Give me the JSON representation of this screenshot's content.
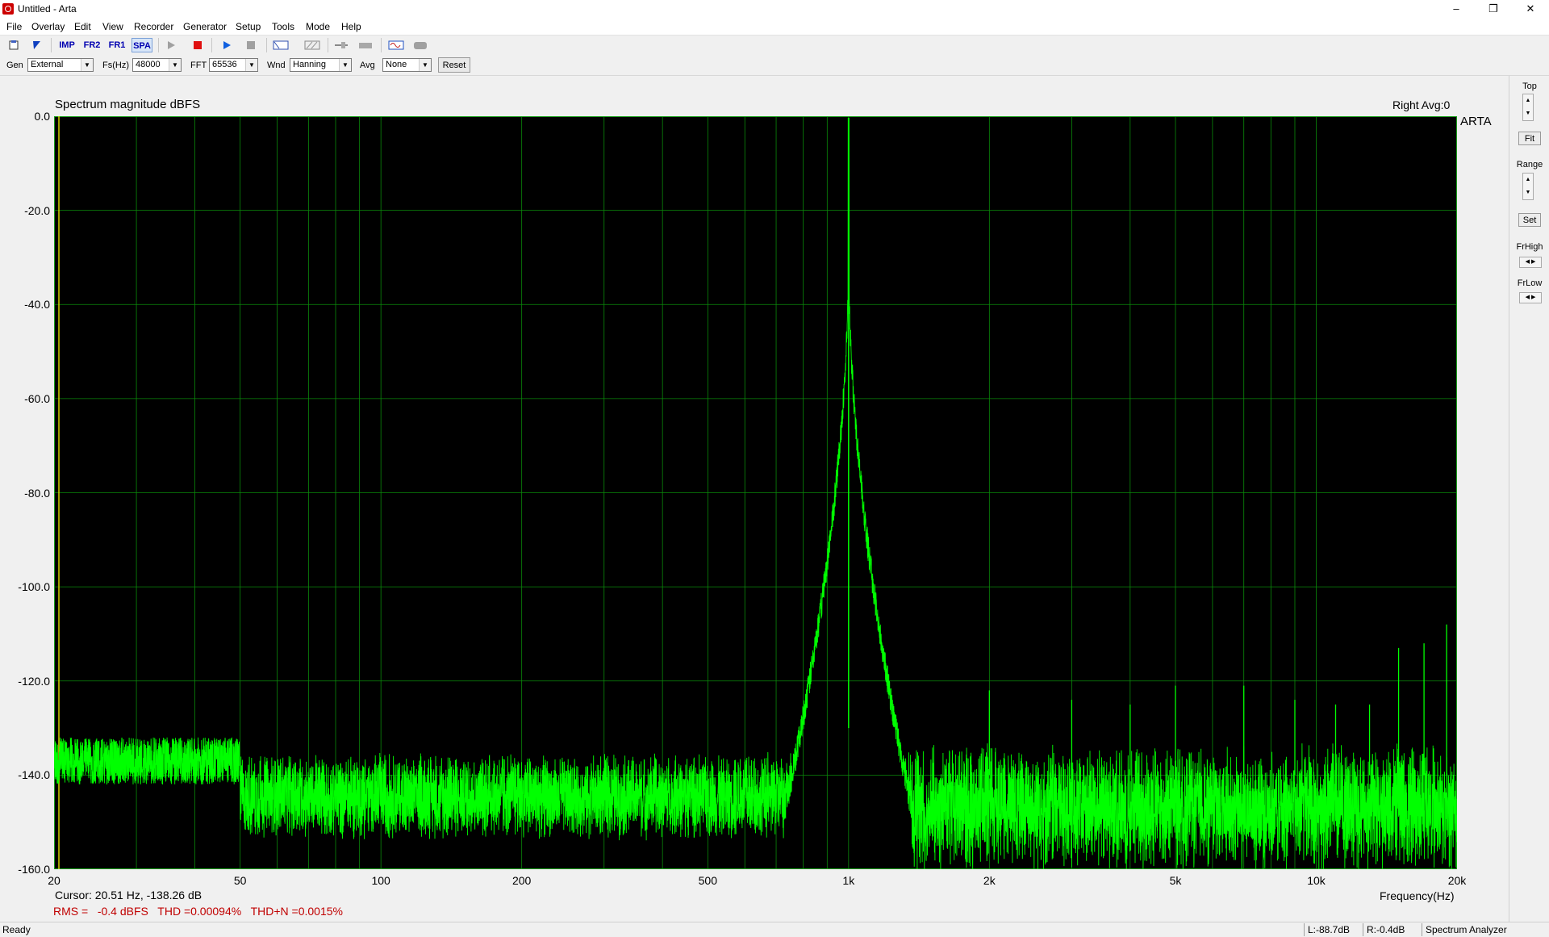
{
  "window": {
    "title": "Untitled - Arta",
    "minimize": "–",
    "restore": "❐",
    "close": "✕"
  },
  "menu": [
    "File",
    "Overlay",
    "Edit",
    "View",
    "Recorder",
    "Generator",
    "Setup",
    "Tools",
    "Mode",
    "Help"
  ],
  "toolbar": {
    "imp": "IMP",
    "fr2": "FR2",
    "fr1": "FR1",
    "spa": "SPA"
  },
  "params": {
    "gen_label": "Gen",
    "gen_value": "External",
    "fs_label": "Fs(Hz)",
    "fs_value": "48000",
    "fft_label": "FFT",
    "fft_value": "65536",
    "wnd_label": "Wnd",
    "wnd_value": "Hanning",
    "avg_label": "Avg",
    "avg_value": "None",
    "reset_label": "Reset"
  },
  "plot": {
    "title": "Spectrum magnitude dBFS",
    "right_label": "Right  Avg:0",
    "logo": "ARTA",
    "xlabel": "Frequency(Hz)",
    "cursor": "Cursor: 20.51 Hz, -138.26 dB",
    "measurement": "RMS =   -0.4 dBFS   THD =0.00094%   THD+N =0.0015%",
    "colors": {
      "background": "#000000",
      "grid": "#0a8a0a",
      "trace": "#00ff00",
      "measure": "#c00000"
    }
  },
  "chart_data": {
    "type": "line",
    "title": "Spectrum magnitude dBFS",
    "xlabel": "Frequency(Hz)",
    "ylabel": "",
    "xscale": "log",
    "xlim": [
      20,
      20000
    ],
    "ylim": [
      -160,
      0
    ],
    "y_ticks": [
      "0.0",
      "-20.0",
      "-40.0",
      "-60.0",
      "-80.0",
      "-100.0",
      "-120.0",
      "-140.0",
      "-160.0"
    ],
    "y_tick_values": [
      0,
      -20,
      -40,
      -60,
      -80,
      -100,
      -120,
      -140,
      -160
    ],
    "x_ticks": [
      "20",
      "50",
      "100",
      "200",
      "500",
      "1k",
      "2k",
      "5k",
      "10k",
      "20k"
    ],
    "x_tick_values": [
      20,
      50,
      100,
      200,
      500,
      1000,
      2000,
      5000,
      10000,
      20000
    ],
    "fundamental": {
      "freq": 1000,
      "level": -0.4
    },
    "noise_floor": -140,
    "harmonics": [
      {
        "freq": 2000,
        "level": -122
      },
      {
        "freq": 3000,
        "level": -124
      },
      {
        "freq": 4000,
        "level": -125
      },
      {
        "freq": 5000,
        "level": -121
      },
      {
        "freq": 7000,
        "level": -121
      },
      {
        "freq": 9000,
        "level": -124
      },
      {
        "freq": 11000,
        "level": -125
      },
      {
        "freq": 13000,
        "level": -125
      },
      {
        "freq": 15000,
        "level": -113
      },
      {
        "freq": 17000,
        "level": -112
      },
      {
        "freq": 19000,
        "level": -108
      }
    ],
    "grid": true
  },
  "sidepanel": {
    "top": "Top",
    "fit": "Fit",
    "range": "Range",
    "set": "Set",
    "frhigh": "FrHigh",
    "frlow": "FrLow"
  },
  "status": {
    "ready": "Ready",
    "left": "L:-88.7dB",
    "right": "R:-0.4dB",
    "mode": "Spectrum Analyzer"
  }
}
